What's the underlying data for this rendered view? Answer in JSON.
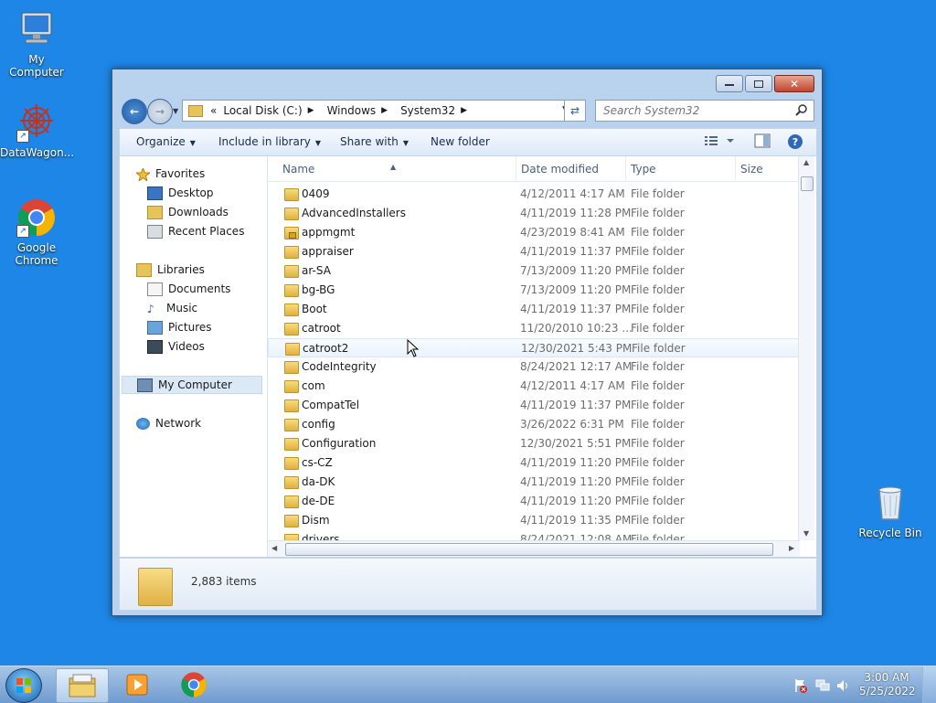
{
  "desktop": {
    "icons": [
      {
        "label": "My Computer",
        "icon": "computer-icon"
      },
      {
        "label": "DataWagon...",
        "icon": "datawagon-icon"
      },
      {
        "label": "Google Chrome",
        "icon": "chrome-icon"
      },
      {
        "label": "Recycle Bin",
        "icon": "recycle-bin-icon"
      }
    ]
  },
  "window": {
    "breadcrumb": {
      "history_icon": "«",
      "items": [
        "Local Disk (C:)",
        "Windows",
        "System32"
      ]
    },
    "search": {
      "placeholder": "Search System32"
    },
    "toolbar": {
      "organize": "Organize",
      "include_in_library": "Include in library",
      "share_with": "Share with",
      "new_folder": "New folder"
    },
    "nav": {
      "favorites": "Favorites",
      "favorites_items": [
        "Desktop",
        "Downloads",
        "Recent Places"
      ],
      "libraries": "Libraries",
      "libraries_items": [
        "Documents",
        "Music",
        "Pictures",
        "Videos"
      ],
      "my_computer": "My Computer",
      "network": "Network"
    },
    "columns": {
      "name": "Name",
      "date": "Date modified",
      "type": "Type",
      "size": "Size"
    },
    "files": [
      {
        "name": "0409",
        "date": "4/12/2011 4:17 AM",
        "type": "File folder"
      },
      {
        "name": "AdvancedInstallers",
        "date": "4/11/2019 11:28 PM",
        "type": "File folder"
      },
      {
        "name": "appmgmt",
        "date": "4/23/2019 8:41 AM",
        "type": "File folder",
        "locked": true
      },
      {
        "name": "appraiser",
        "date": "4/11/2019 11:37 PM",
        "type": "File folder"
      },
      {
        "name": "ar-SA",
        "date": "7/13/2009 11:20 PM",
        "type": "File folder"
      },
      {
        "name": "bg-BG",
        "date": "7/13/2009 11:20 PM",
        "type": "File folder"
      },
      {
        "name": "Boot",
        "date": "4/11/2019 11:37 PM",
        "type": "File folder"
      },
      {
        "name": "catroot",
        "date": "11/20/2010 10:23 ...",
        "type": "File folder"
      },
      {
        "name": "catroot2",
        "date": "12/30/2021 5:43 PM",
        "type": "File folder",
        "hover": true
      },
      {
        "name": "CodeIntegrity",
        "date": "8/24/2021 12:17 AM",
        "type": "File folder"
      },
      {
        "name": "com",
        "date": "4/12/2011 4:17 AM",
        "type": "File folder"
      },
      {
        "name": "CompatTel",
        "date": "4/11/2019 11:37 PM",
        "type": "File folder"
      },
      {
        "name": "config",
        "date": "3/26/2022 6:31 PM",
        "type": "File folder"
      },
      {
        "name": "Configuration",
        "date": "12/30/2021 5:51 PM",
        "type": "File folder"
      },
      {
        "name": "cs-CZ",
        "date": "4/11/2019 11:20 PM",
        "type": "File folder"
      },
      {
        "name": "da-DK",
        "date": "4/11/2019 11:20 PM",
        "type": "File folder"
      },
      {
        "name": "de-DE",
        "date": "4/11/2019 11:20 PM",
        "type": "File folder"
      },
      {
        "name": "Dism",
        "date": "4/11/2019 11:35 PM",
        "type": "File folder"
      },
      {
        "name": "drivers",
        "date": "8/24/2021 12:08 AM",
        "type": "File folder"
      }
    ],
    "details": {
      "item_count": "2,883 items"
    }
  },
  "taskbar": {
    "time": "3:00 AM",
    "date": "5/25/2022",
    "apps": [
      "explorer-icon",
      "media-player-icon",
      "chrome-icon"
    ]
  }
}
